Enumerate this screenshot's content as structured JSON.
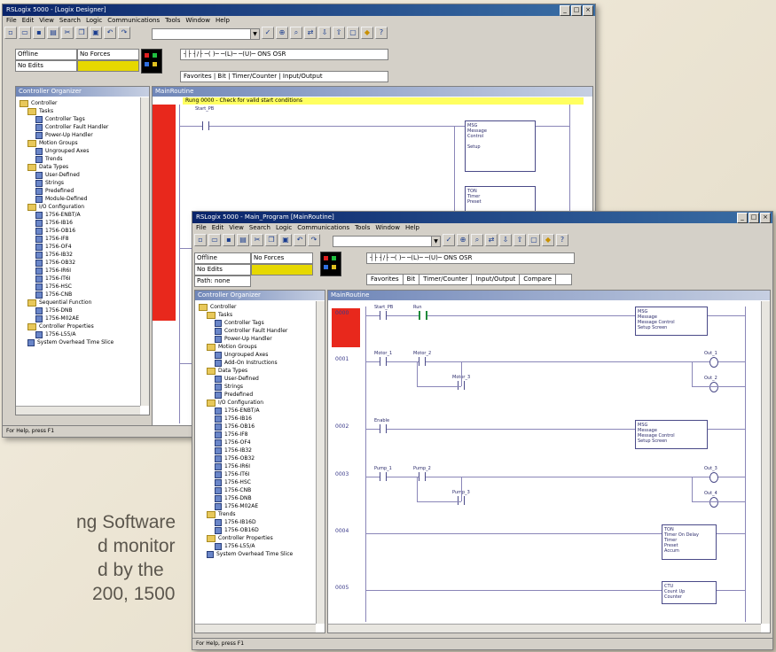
{
  "background_text": {
    "lines": [
      "ng Software",
      "d monitor",
      "d by the",
      "200, 1500"
    ]
  },
  "back_window": {
    "title": "RSLogix 5000 - [Logix Designer]",
    "menu": [
      "File",
      "Edit",
      "View",
      "Search",
      "Logic",
      "Communications",
      "Tools",
      "Window",
      "Help"
    ],
    "mode_combo": "Offline",
    "mode_status": "No Forces",
    "edits_status": "No Edits",
    "path_combo": "",
    "controller_panel_title": "Controller Organizer",
    "ladder_title": "MainRoutine",
    "comment_text": "Rung 0000 - Check for valid start conditions",
    "contact_label": "Start_PB",
    "status_text": "For Help, press F1",
    "tree": [
      {
        "label": "Controller",
        "kind": "folder",
        "indent": 0
      },
      {
        "label": "Tasks",
        "kind": "folder",
        "indent": 1
      },
      {
        "label": "Controller Tags",
        "kind": "leaf",
        "indent": 2
      },
      {
        "label": "Controller Fault Handler",
        "kind": "leaf",
        "indent": 2
      },
      {
        "label": "Power-Up Handler",
        "kind": "leaf",
        "indent": 2
      },
      {
        "label": "Motion Groups",
        "kind": "folder",
        "indent": 1
      },
      {
        "label": "Ungrouped Axes",
        "kind": "leaf",
        "indent": 2
      },
      {
        "label": "Trends",
        "kind": "leaf",
        "indent": 2
      },
      {
        "label": "Data Types",
        "kind": "folder",
        "indent": 1
      },
      {
        "label": "User-Defined",
        "kind": "leaf",
        "indent": 2
      },
      {
        "label": "Strings",
        "kind": "leaf",
        "indent": 2
      },
      {
        "label": "Predefined",
        "kind": "leaf",
        "indent": 2
      },
      {
        "label": "Module-Defined",
        "kind": "leaf",
        "indent": 2
      },
      {
        "label": "I/O Configuration",
        "kind": "folder",
        "indent": 1
      },
      {
        "label": "1756-ENBT/A",
        "kind": "leaf",
        "indent": 2
      },
      {
        "label": "1756-IB16",
        "kind": "leaf",
        "indent": 2
      },
      {
        "label": "1756-OB16",
        "kind": "leaf",
        "indent": 2
      },
      {
        "label": "1756-IF8",
        "kind": "leaf",
        "indent": 2
      },
      {
        "label": "1756-OF4",
        "kind": "leaf",
        "indent": 2
      },
      {
        "label": "1756-IB32",
        "kind": "leaf",
        "indent": 2
      },
      {
        "label": "1756-OB32",
        "kind": "leaf",
        "indent": 2
      },
      {
        "label": "1756-IR6I",
        "kind": "leaf",
        "indent": 2
      },
      {
        "label": "1756-IT6I",
        "kind": "leaf",
        "indent": 2
      },
      {
        "label": "1756-HSC",
        "kind": "leaf",
        "indent": 2
      },
      {
        "label": "1756-CNB",
        "kind": "leaf",
        "indent": 2
      },
      {
        "label": "Sequential Function",
        "kind": "folder",
        "indent": 1
      },
      {
        "label": "1756-DNB",
        "kind": "leaf",
        "indent": 2
      },
      {
        "label": "1756-M02AE",
        "kind": "leaf",
        "indent": 2
      },
      {
        "label": "Controller Properties",
        "kind": "folder",
        "indent": 1
      },
      {
        "label": "1756-L55/A",
        "kind": "leaf",
        "indent": 2
      },
      {
        "label": "System Overhead Time Slice",
        "kind": "leaf",
        "indent": 1
      }
    ]
  },
  "front_window": {
    "title": "RSLogix 5000 - Main_Program [MainRoutine]",
    "menu": [
      "File",
      "Edit",
      "View",
      "Search",
      "Logic",
      "Communications",
      "Tools",
      "Window",
      "Help"
    ],
    "mode_combo": "Offline",
    "mode_status": "No Forces",
    "edits_status": "No Edits",
    "path_combo": "Path: none",
    "instruction_tabs": [
      "Favorites",
      "Bit",
      "Timer/Counter",
      "Input/Output",
      "Compare"
    ],
    "controller_panel_title": "Controller Organizer",
    "ladder_title": "MainRoutine",
    "tree": [
      {
        "label": "Controller",
        "kind": "folder",
        "indent": 0
      },
      {
        "label": "Tasks",
        "kind": "folder",
        "indent": 1
      },
      {
        "label": "Controller Tags",
        "kind": "leaf",
        "indent": 2
      },
      {
        "label": "Controller Fault Handler",
        "kind": "leaf",
        "indent": 2
      },
      {
        "label": "Power-Up Handler",
        "kind": "leaf",
        "indent": 2
      },
      {
        "label": "Motion Groups",
        "kind": "folder",
        "indent": 1
      },
      {
        "label": "Ungrouped Axes",
        "kind": "leaf",
        "indent": 2
      },
      {
        "label": "Add-On Instructions",
        "kind": "leaf",
        "indent": 2
      },
      {
        "label": "Data Types",
        "kind": "folder",
        "indent": 1
      },
      {
        "label": "User-Defined",
        "kind": "leaf",
        "indent": 2
      },
      {
        "label": "Strings",
        "kind": "leaf",
        "indent": 2
      },
      {
        "label": "Predefined",
        "kind": "leaf",
        "indent": 2
      },
      {
        "label": "I/O Configuration",
        "kind": "folder",
        "indent": 1
      },
      {
        "label": "1756-ENBT/A",
        "kind": "leaf",
        "indent": 2
      },
      {
        "label": "1756-IB16",
        "kind": "leaf",
        "indent": 2
      },
      {
        "label": "1756-OB16",
        "kind": "leaf",
        "indent": 2
      },
      {
        "label": "1756-IF8",
        "kind": "leaf",
        "indent": 2
      },
      {
        "label": "1756-OF4",
        "kind": "leaf",
        "indent": 2
      },
      {
        "label": "1756-IB32",
        "kind": "leaf",
        "indent": 2
      },
      {
        "label": "1756-OB32",
        "kind": "leaf",
        "indent": 2
      },
      {
        "label": "1756-IR6I",
        "kind": "leaf",
        "indent": 2
      },
      {
        "label": "1756-IT6I",
        "kind": "leaf",
        "indent": 2
      },
      {
        "label": "1756-HSC",
        "kind": "leaf",
        "indent": 2
      },
      {
        "label": "1756-CNB",
        "kind": "leaf",
        "indent": 2
      },
      {
        "label": "1756-DNB",
        "kind": "leaf",
        "indent": 2
      },
      {
        "label": "1756-M02AE",
        "kind": "leaf",
        "indent": 2
      },
      {
        "label": "Trends",
        "kind": "folder",
        "indent": 1
      },
      {
        "label": "1756-IB16D",
        "kind": "leaf",
        "indent": 2
      },
      {
        "label": "1756-OB16D",
        "kind": "leaf",
        "indent": 2
      },
      {
        "label": "Controller Properties",
        "kind": "folder",
        "indent": 1
      },
      {
        "label": "1756-L55/A",
        "kind": "leaf",
        "indent": 2
      },
      {
        "label": "System Overhead Time Slice",
        "kind": "leaf",
        "indent": 1
      }
    ],
    "rungs": [
      {
        "number": "0000",
        "contacts": [
          "Start_PB",
          "Run"
        ],
        "box": {
          "title": "MSG",
          "lines": [
            "Message",
            "Message Control",
            "Setup Screen"
          ]
        }
      },
      {
        "number": "0001",
        "contacts": [
          "Motor_1",
          "Motor_2",
          "Motor_3"
        ],
        "coils": [
          "Out_1",
          "Out_2"
        ]
      },
      {
        "number": "0002",
        "contacts": [
          "Enable"
        ],
        "box": {
          "title": "MSG",
          "lines": [
            "Message",
            "Message Control",
            "Setup Screen"
          ]
        }
      },
      {
        "number": "0003",
        "contacts": [
          "Pump_1",
          "Pump_2",
          "Pump_3"
        ],
        "coils": [
          "Out_3",
          "Out_4"
        ]
      },
      {
        "number": "0004",
        "contacts": [],
        "box": {
          "title": "TON",
          "lines": [
            "Timer On Delay",
            "Timer",
            "Preset",
            "Accum"
          ]
        }
      },
      {
        "number": "0005",
        "contacts": [],
        "box": {
          "title": "CTU",
          "lines": [
            "Count Up",
            "Counter"
          ]
        }
      }
    ],
    "status_text": "For Help, press F1"
  }
}
